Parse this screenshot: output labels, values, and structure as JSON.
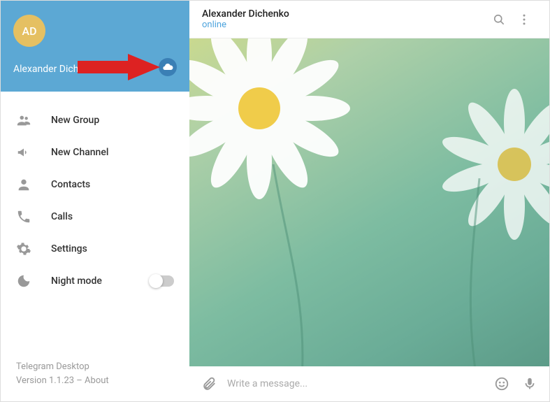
{
  "sidebar": {
    "avatar_initials": "AD",
    "username": "Alexander Dichenko",
    "menu": [
      {
        "icon": "group",
        "label": "New Group"
      },
      {
        "icon": "channel",
        "label": "New Channel"
      },
      {
        "icon": "contacts",
        "label": "Contacts"
      },
      {
        "icon": "calls",
        "label": "Calls"
      },
      {
        "icon": "settings",
        "label": "Settings"
      },
      {
        "icon": "night",
        "label": "Night mode"
      }
    ],
    "footer": {
      "app_name": "Telegram Desktop",
      "version_line": "Version 1.1.23 – About"
    }
  },
  "chat": {
    "title": "Alexander Dichenko",
    "status": "online",
    "composer_placeholder": "Write a message..."
  },
  "colors": {
    "header_bg": "#5ca8d4",
    "avatar_bg": "#e5c062",
    "accent_link": "#4ea4dd"
  }
}
